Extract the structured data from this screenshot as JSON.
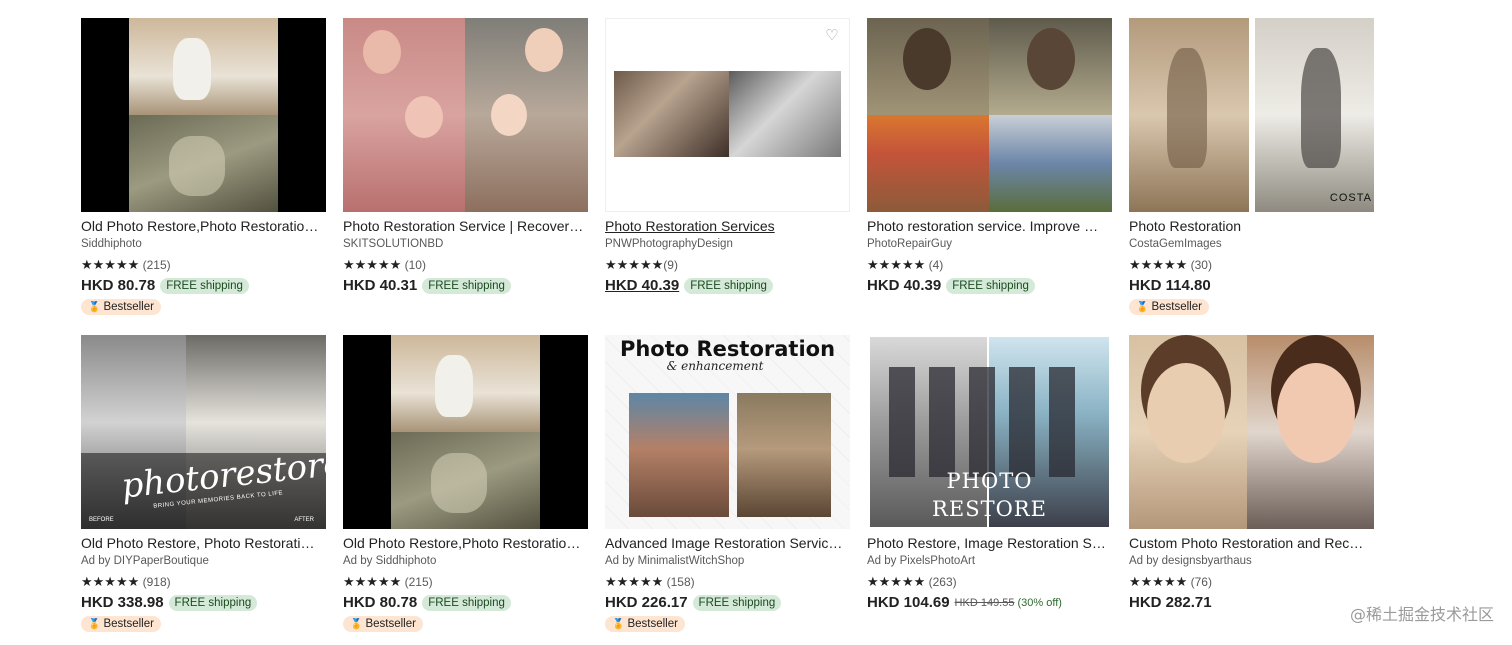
{
  "colors": {
    "free_shipping_bg": "#d4e9d7",
    "bestseller_bg": "#fde5d2",
    "discount_text": "#2e6b30"
  },
  "row1": [
    {
      "title": "Old Photo Restore,Photo Restoration…",
      "shop": "Siddhiphoto",
      "stars": "★★★★★",
      "reviews": "(215)",
      "price": "HKD 80.78",
      "shipping": "FREE shipping",
      "badge": "Bestseller",
      "badge_icon": "medal-icon"
    },
    {
      "title": "Photo Restoration Service | Recover…",
      "shop": "SKITSOLUTIONBD",
      "stars": "★★★★★",
      "reviews": "(10)",
      "price": "HKD 40.31",
      "shipping": "FREE shipping"
    },
    {
      "title": "Photo Restoration Services",
      "shop": "PNWPhotographyDesign",
      "stars": "★★★★★",
      "reviews": "(9)",
      "price": "HKD 40.39",
      "shipping": "FREE shipping",
      "favorite_icon": "heart-icon"
    },
    {
      "title": "Photo restoration service. Improve …",
      "shop": "PhotoRepairGuy",
      "stars": "★★★★★",
      "reviews": "(4)",
      "price": "HKD 40.39",
      "shipping": "FREE shipping"
    },
    {
      "title": "Photo Restoration",
      "shop": "CostaGemImages",
      "stars": "★★★★★",
      "reviews": "(30)",
      "price": "HKD 114.80",
      "badge": "Bestseller",
      "badge_icon": "medal-icon",
      "image_text": "COSTA"
    }
  ],
  "row2": [
    {
      "title": "Old Photo Restore, Photo Restorati…",
      "shop": "Ad by DIYPaperBoutique",
      "stars": "★★★★★",
      "reviews": "(918)",
      "price": "HKD 338.98",
      "shipping": "FREE shipping",
      "badge": "Bestseller",
      "badge_icon": "medal-icon",
      "image_text": "photorestore",
      "image_subtext": "BRING YOUR MEMORIES BACK TO LIFE",
      "image_before": "BEFORE",
      "image_after": "AFTER"
    },
    {
      "title": "Old Photo Restore,Photo Restoration…",
      "shop": "Ad by Siddhiphoto",
      "stars": "★★★★★",
      "reviews": "(215)",
      "price": "HKD 80.78",
      "shipping": "FREE shipping",
      "badge": "Bestseller",
      "badge_icon": "medal-icon"
    },
    {
      "title": "Advanced Image Restoration Servic…",
      "shop": "Ad by MinimalistWitchShop",
      "stars": "★★★★★",
      "reviews": "(158)",
      "price": "HKD 226.17",
      "shipping": "FREE shipping",
      "badge": "Bestseller",
      "badge_icon": "medal-icon",
      "image_text": "Photo Restoration",
      "image_subtext": "& enhancement"
    },
    {
      "title": "Photo Restore, Image Restoration S…",
      "shop": "Ad by PixelsPhotoArt",
      "stars": "★★★★★",
      "reviews": "(263)",
      "price": "HKD 104.69",
      "original_price": "HKD 149.55",
      "discount": "(30% off)",
      "image_text": "PHOTO",
      "image_subtext": "RESTORE"
    },
    {
      "title": "Custom Photo Restoration and Rec…",
      "shop": "Ad by designsbyarthaus",
      "stars": "★★★★★",
      "reviews": "(76)",
      "price": "HKD 282.71"
    }
  ],
  "watermark": "@稀土掘金技术社区"
}
